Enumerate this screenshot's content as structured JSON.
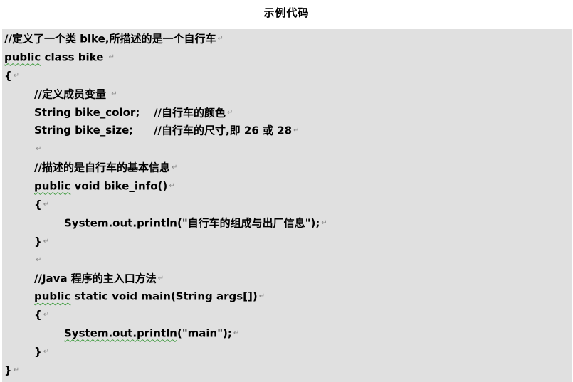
{
  "title": "示例代码",
  "paragraph_mark": "↵",
  "code": {
    "l1": "//定义了一个类 bike,所描述的是一个自行车",
    "l2_kw": "public",
    "l2_rest": " class bike ",
    "l3": "{",
    "l4": "//定义成员变量 ",
    "l5_code": "String bike_color;",
    "l5_comment": "//自行车的颜色",
    "l6_code": "String bike_size;",
    "l6_comment": "//自行车的尺寸,即 26 或 28",
    "l8": "//描述的是自行车的基本信息",
    "l9_kw": "public",
    "l9_rest": " void bike_info()",
    "l10": "{",
    "l11": "System.out.println(\"自行车的组成与出厂信息\");",
    "l12": "}",
    "l14": "//Java 程序的主入口方法",
    "l15_kw": "public",
    "l15_rest": " static void main(String args[])",
    "l16": "{",
    "l17_a": "System.out.println",
    "l17_b": "(\"main\");",
    "l18": "}",
    "l19": "}"
  }
}
